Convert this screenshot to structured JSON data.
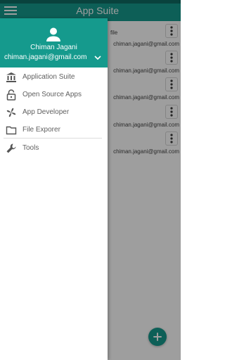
{
  "appbar": {
    "title": "App Suite"
  },
  "cards": [
    {
      "file_label": "file",
      "email": "chiman.jagani@gmail.com"
    },
    {
      "file_label": "",
      "email": "chiman.jagani@gmail.com"
    },
    {
      "file_label": "",
      "email": "chiman.jagani@gmail.com"
    },
    {
      "file_label": "",
      "email": "chiman.jagani@gmail.com"
    },
    {
      "file_label": "",
      "email": "chiman.jagani@gmail.com"
    }
  ],
  "drawer": {
    "user_name": "Chiman Jagani",
    "user_email": "chiman.jagani@gmail.com",
    "items": [
      {
        "label": "Application Suite",
        "icon": "bank-icon"
      },
      {
        "label": "Open Source Apps",
        "icon": "lock-open-icon"
      },
      {
        "label": "App Developer",
        "icon": "pinwheel-icon"
      },
      {
        "label": "File Exporer",
        "icon": "folder-icon"
      },
      {
        "label": "Tools",
        "icon": "wrench-icon"
      }
    ]
  },
  "colors": {
    "primary": "#159a8d",
    "primary_dark": "#0f6b63",
    "text": "#5f5f5f"
  }
}
